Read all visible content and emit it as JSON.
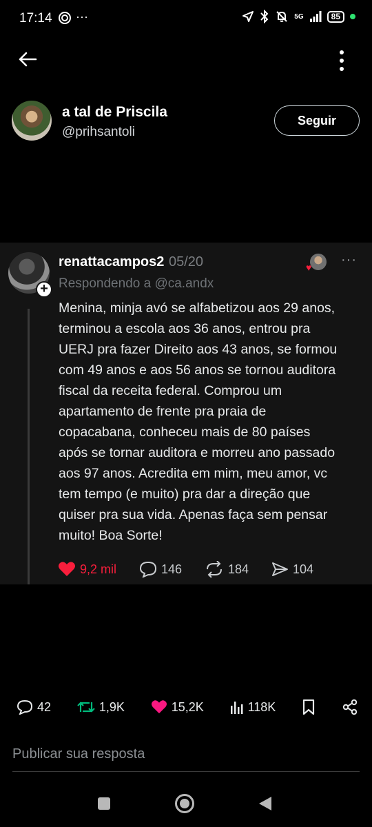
{
  "status_bar": {
    "time": "17:14",
    "network": "5G",
    "battery": "85"
  },
  "tweet": {
    "author_name": "a tal de Priscila",
    "author_handle": "@prihsantoli",
    "follow_label": "Seguir"
  },
  "quoted": {
    "username": "renattacampos2",
    "date": "05/20",
    "replying_to": "Respondendo a @ca.andx",
    "text": "Menina, minja avó se alfabetizou aos 29 anos,\nterminou a escola aos 36 anos, entrou pra\nUERJ pra fazer Direito aos 43 anos, se formou\ncom  49 anos e aos 56 anos se tornou auditora\nfiscal da receita federal. Comprou um\napartamento de frente pra praia de\ncopacabana, conheceu mais de 80 países\napós se tornar auditora e morreu ano passado\naos 97 anos. Acredita em mim, meu amor, vc\ntem tempo (e muito) pra dar a direção que\nquiser pra sua vida. Apenas faça sem pensar\nmuito! Boa Sorte!",
    "likes": "9,2 mil",
    "comments": "146",
    "reposts": "184",
    "shares": "104"
  },
  "metrics": {
    "replies": "42",
    "retweets": "1,9K",
    "likes": "15,2K",
    "views": "118K"
  },
  "reply_placeholder": "Publicar sua resposta",
  "colors": {
    "like": "#f91e3c",
    "retweet": "#00ba7c",
    "like_pink": "#f91880"
  },
  "icons": [
    "back-arrow-icon",
    "more-vertical-icon",
    "heart-icon",
    "comment-icon",
    "repost-icon",
    "share-icon",
    "bookmark-icon",
    "views-icon"
  ]
}
